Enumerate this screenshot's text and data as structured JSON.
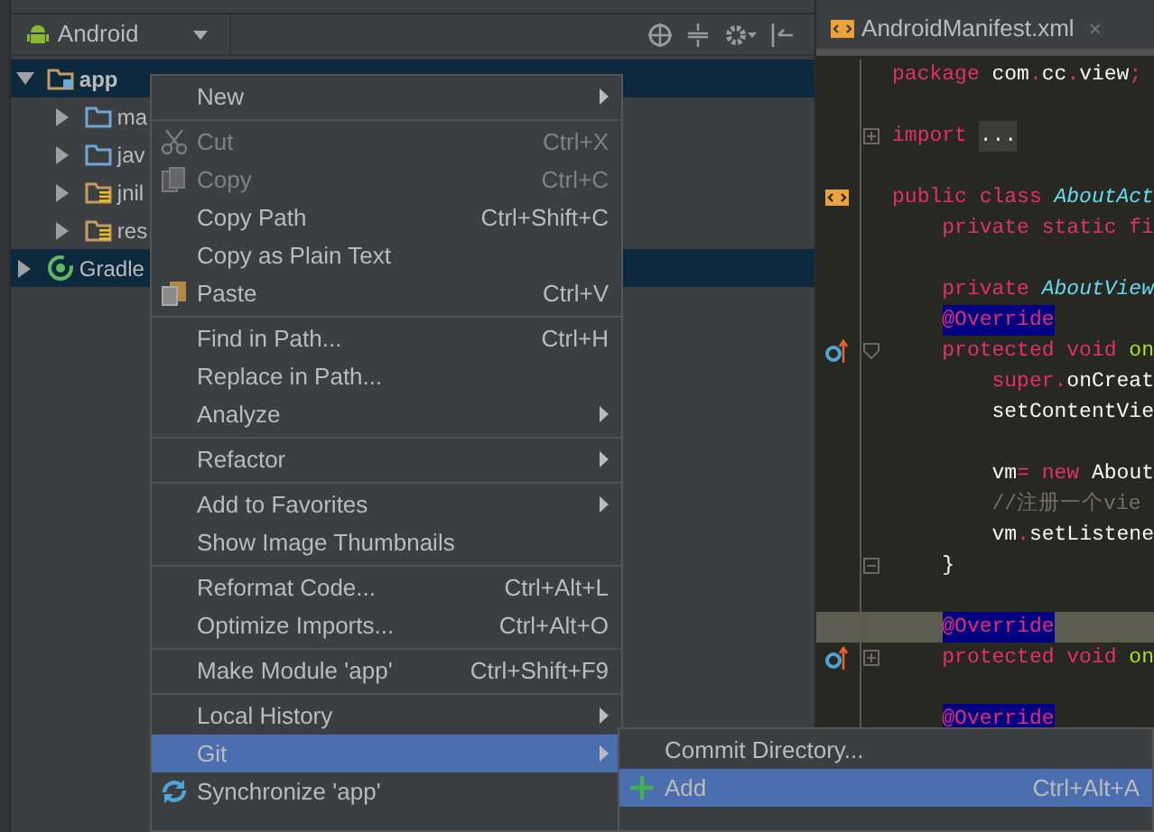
{
  "toolbar": {
    "view_selector": "Android"
  },
  "tree": [
    {
      "label": "app",
      "kind": "module",
      "selected": true,
      "expanded": true,
      "children": [
        {
          "label": "ma",
          "kind": "folder",
          "selected": false,
          "expanded": false
        },
        {
          "label": "jav",
          "kind": "folder",
          "selected": false,
          "expanded": false
        },
        {
          "label": "jnil",
          "kind": "resfolder",
          "selected": false,
          "expanded": false
        },
        {
          "label": "res",
          "kind": "resfolder",
          "selected": false,
          "expanded": false
        }
      ]
    },
    {
      "label": "Gradle",
      "kind": "gradle",
      "selected": true,
      "expanded": false
    }
  ],
  "editor_tab": {
    "title": "AndroidManifest.xml",
    "close": "×"
  },
  "code_lines": [
    {
      "segments": [
        {
          "kind": "kw",
          "text": "package"
        },
        {
          "kind": "plain",
          "text": " com"
        },
        {
          "kind": "kw",
          "text": "."
        },
        {
          "kind": "plain",
          "text": "cc"
        },
        {
          "kind": "kw",
          "text": "."
        },
        {
          "kind": "plain",
          "text": "view"
        },
        {
          "kind": "kw",
          "text": ";"
        }
      ]
    },
    {
      "blank_line_before": true,
      "folded": true,
      "segments": [
        {
          "kind": "kw",
          "text": "import "
        },
        {
          "kind": "folded",
          "text": "..."
        }
      ]
    },
    {
      "blank_line_before": true,
      "manifest_link": true,
      "segments": [
        {
          "kind": "kw",
          "text": "public class "
        },
        {
          "kind": "type",
          "text": "AboutAct"
        }
      ]
    },
    {
      "segments": [
        {
          "kind": "kw",
          "text": "    private static fi"
        }
      ]
    },
    {
      "blank_line_before": true,
      "segments": [
        {
          "kind": "kw",
          "text": "    private "
        },
        {
          "kind": "type",
          "text": "AboutView"
        }
      ]
    },
    {
      "segments": [
        {
          "kind": "annotation",
          "text": "    @Override"
        }
      ]
    },
    {
      "overrides": true,
      "fold_start": true,
      "segments": [
        {
          "kind": "kw",
          "text": "    protected void "
        },
        {
          "kind": "method",
          "text": "on"
        }
      ]
    },
    {
      "segments": [
        {
          "kind": "kw",
          "text": "        super."
        },
        {
          "kind": "plain",
          "text": "onCreat"
        }
      ]
    },
    {
      "segments": [
        {
          "kind": "plain",
          "text": "        setContentVie"
        }
      ]
    },
    {
      "blank_line_before": true,
      "segments": [
        {
          "kind": "plain",
          "text": "        vm"
        },
        {
          "kind": "kw",
          "text": "= new"
        },
        {
          "kind": "plain",
          "text": " About"
        }
      ]
    },
    {
      "segments": [
        {
          "kind": "comment",
          "text": "        //注册一个vie"
        }
      ]
    },
    {
      "segments": [
        {
          "kind": "plain",
          "text": "        vm"
        },
        {
          "kind": "kw",
          "text": "."
        },
        {
          "kind": "plain",
          "text": "setListene"
        }
      ]
    },
    {
      "fold_end": true,
      "segments": [
        {
          "kind": "plain",
          "text": "    }"
        }
      ]
    },
    {
      "blank_line_before": true,
      "highlighted": true,
      "segments": [
        {
          "kind": "annotation",
          "text": "    @Override"
        }
      ]
    },
    {
      "overrides": true,
      "folded": true,
      "segments": [
        {
          "kind": "kw",
          "text": "    protected void "
        },
        {
          "kind": "method",
          "text": "on"
        }
      ]
    },
    {
      "blank_line_before": true,
      "segments": [
        {
          "kind": "annotation",
          "text": "    @Override"
        }
      ]
    }
  ],
  "context_menu": {
    "groups": [
      [
        {
          "label": "New",
          "submenu": true,
          "disabled": false,
          "selected": false
        }
      ],
      [
        {
          "label": "Cut",
          "shortcut": "Ctrl+X",
          "kind": "scissors",
          "disabled": true,
          "selected": false
        },
        {
          "label": "Copy",
          "shortcut": "Ctrl+C",
          "kind": "copy",
          "disabled": true,
          "selected": false
        },
        {
          "label": "Copy Path",
          "shortcut": "Ctrl+Shift+C",
          "disabled": false,
          "selected": false
        },
        {
          "label": "Copy as Plain Text",
          "disabled": false,
          "selected": false
        },
        {
          "label": "Paste",
          "shortcut": "Ctrl+V",
          "kind": "paste",
          "disabled": false,
          "selected": false
        }
      ],
      [
        {
          "label": "Find in Path...",
          "shortcut": "Ctrl+H",
          "disabled": false,
          "selected": false
        },
        {
          "label": "Replace in Path...",
          "disabled": false,
          "selected": false
        },
        {
          "label": "Analyze",
          "submenu": true,
          "disabled": false,
          "selected": false
        }
      ],
      [
        {
          "label": "Refactor",
          "submenu": true,
          "disabled": false,
          "selected": false
        }
      ],
      [
        {
          "label": "Add to Favorites",
          "submenu": true,
          "disabled": false,
          "selected": false
        },
        {
          "label": "Show Image Thumbnails",
          "disabled": false,
          "selected": false
        }
      ],
      [
        {
          "label": "Reformat Code...",
          "shortcut": "Ctrl+Alt+L",
          "disabled": false,
          "selected": false
        },
        {
          "label": "Optimize Imports...",
          "shortcut": "Ctrl+Alt+O",
          "disabled": false,
          "selected": false
        }
      ],
      [
        {
          "label": "Make Module 'app'",
          "shortcut": "Ctrl+Shift+F9",
          "disabled": false,
          "selected": false
        }
      ],
      [
        {
          "label": "Local History",
          "submenu": true,
          "disabled": false,
          "selected": false
        },
        {
          "label": "Git",
          "submenu": true,
          "disabled": false,
          "selected": true
        },
        {
          "label": "Synchronize 'app'",
          "kind": "sync",
          "disabled": false,
          "selected": false
        }
      ]
    ]
  },
  "git_submenu": [
    {
      "label": "Commit Directory...",
      "selected": false
    },
    {
      "label": "Add",
      "shortcut": "Ctrl+Alt+A",
      "kind": "plus",
      "selected": true
    }
  ]
}
